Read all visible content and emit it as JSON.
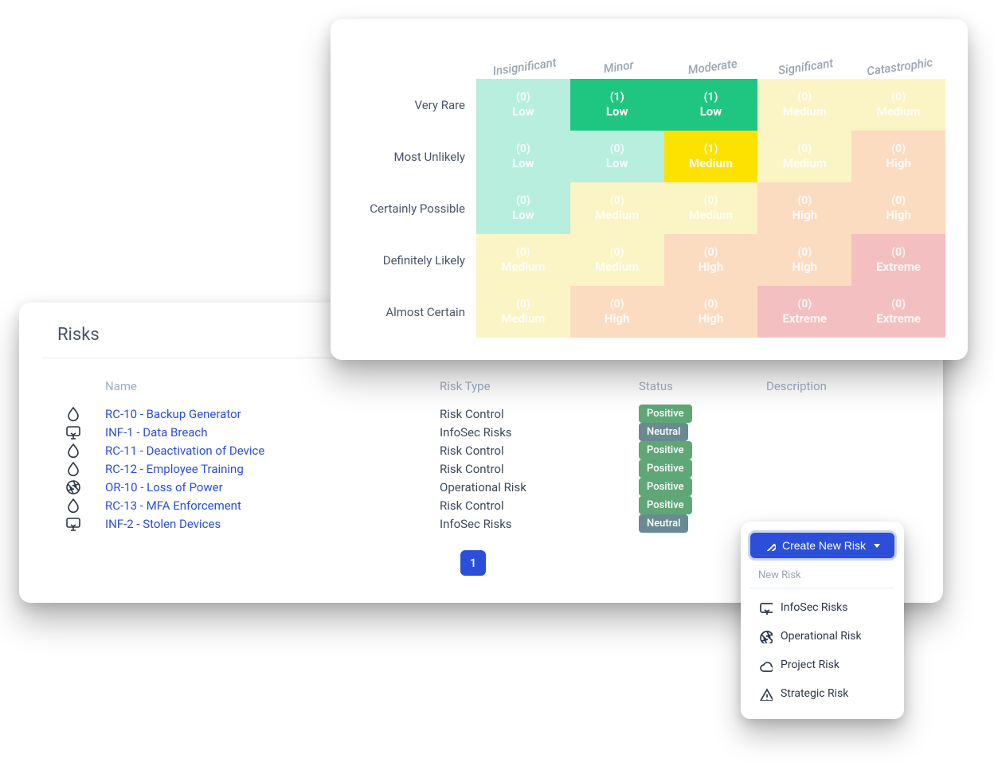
{
  "heatmap": {
    "columns": [
      "Insignificant",
      "Minor",
      "Moderate",
      "Significant",
      "Catastrophic"
    ],
    "rows": [
      "Very Rare",
      "Most Unlikely",
      "Certainly Possible",
      "Definitely Likely",
      "Almost Certain"
    ],
    "cells": [
      [
        {
          "count": 0,
          "label": "Low",
          "cls": "c-low-a"
        },
        {
          "count": 1,
          "label": "Low",
          "cls": "c-low-b"
        },
        {
          "count": 1,
          "label": "Low",
          "cls": "c-low-b"
        },
        {
          "count": 0,
          "label": "Medium",
          "cls": "c-med-a"
        },
        {
          "count": 0,
          "label": "Medium",
          "cls": "c-med-a"
        }
      ],
      [
        {
          "count": 0,
          "label": "Low",
          "cls": "c-low-a"
        },
        {
          "count": 0,
          "label": "Low",
          "cls": "c-low-a"
        },
        {
          "count": 1,
          "label": "Medium",
          "cls": "c-med-b"
        },
        {
          "count": 0,
          "label": "Medium",
          "cls": "c-med-a"
        },
        {
          "count": 0,
          "label": "High",
          "cls": "c-high-a"
        }
      ],
      [
        {
          "count": 0,
          "label": "Low",
          "cls": "c-low-a"
        },
        {
          "count": 0,
          "label": "Medium",
          "cls": "c-med-a"
        },
        {
          "count": 0,
          "label": "Medium",
          "cls": "c-med-a"
        },
        {
          "count": 0,
          "label": "High",
          "cls": "c-high-a"
        },
        {
          "count": 0,
          "label": "High",
          "cls": "c-high-a"
        }
      ],
      [
        {
          "count": 0,
          "label": "Medium",
          "cls": "c-med-a"
        },
        {
          "count": 0,
          "label": "Medium",
          "cls": "c-med-a"
        },
        {
          "count": 0,
          "label": "High",
          "cls": "c-high-a"
        },
        {
          "count": 0,
          "label": "High",
          "cls": "c-high-a"
        },
        {
          "count": 0,
          "label": "Extreme",
          "cls": "c-ext-a"
        }
      ],
      [
        {
          "count": 0,
          "label": "Medium",
          "cls": "c-med-a"
        },
        {
          "count": 0,
          "label": "High",
          "cls": "c-high-a"
        },
        {
          "count": 0,
          "label": "High",
          "cls": "c-high-a"
        },
        {
          "count": 0,
          "label": "Extreme",
          "cls": "c-ext-a"
        },
        {
          "count": 0,
          "label": "Extreme",
          "cls": "c-ext-a"
        }
      ]
    ]
  },
  "risks": {
    "title": "Risks",
    "headers": {
      "name": "Name",
      "type": "Risk Type",
      "status": "Status",
      "description": "Description"
    },
    "rows": [
      {
        "icon": "drop",
        "name": "RC-10 - Backup Generator",
        "type": "Risk Control",
        "status": "Positive",
        "statusKind": "positive"
      },
      {
        "icon": "monitor",
        "name": "INF-1 - Data Breach",
        "type": "InfoSec Risks",
        "status": "Neutral",
        "statusKind": "neutral"
      },
      {
        "icon": "drop",
        "name": "RC-11 - Deactivation of Device",
        "type": "Risk Control",
        "status": "Positive",
        "statusKind": "positive"
      },
      {
        "icon": "drop",
        "name": "RC-12 - Employee Training",
        "type": "Risk Control",
        "status": "Positive",
        "statusKind": "positive"
      },
      {
        "icon": "aperture",
        "name": "OR-10 - Loss of Power",
        "type": "Operational Risk",
        "status": "Positive",
        "statusKind": "positive"
      },
      {
        "icon": "drop",
        "name": "RC-13 - MFA Enforcement",
        "type": "Risk Control",
        "status": "Positive",
        "statusKind": "positive"
      },
      {
        "icon": "monitor",
        "name": "INF-2 - Stolen Devices",
        "type": "InfoSec Risks",
        "status": "Neutral",
        "statusKind": "neutral"
      }
    ],
    "page": "1"
  },
  "create": {
    "button": "Create New Risk",
    "section": "New Risk",
    "items": [
      {
        "icon": "monitor",
        "label": "InfoSec Risks"
      },
      {
        "icon": "aperture",
        "label": "Operational Risk"
      },
      {
        "icon": "cloud",
        "label": "Project Risk"
      },
      {
        "icon": "warning",
        "label": "Strategic Risk"
      }
    ]
  }
}
